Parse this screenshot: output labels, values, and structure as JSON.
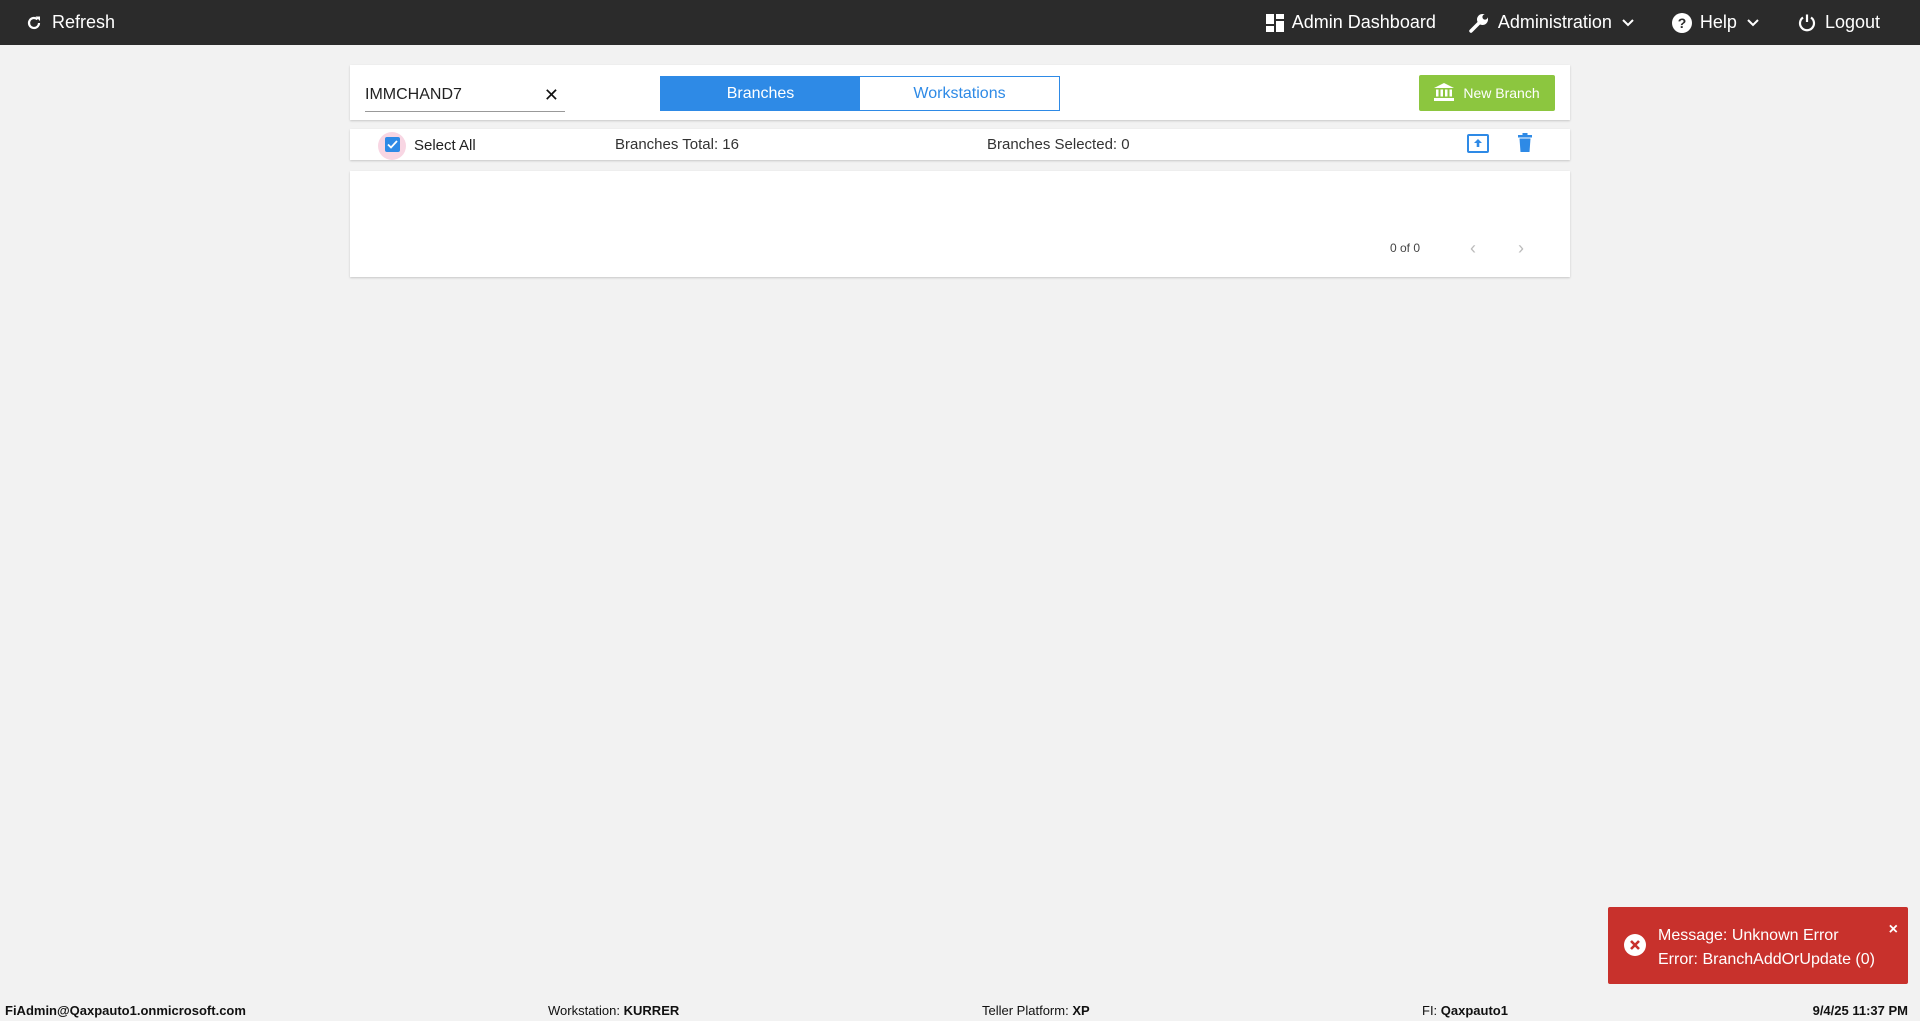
{
  "topbar": {
    "refresh_label": "Refresh",
    "admin_dashboard_label": "Admin Dashboard",
    "administration_label": "Administration",
    "help_label": "Help",
    "logout_label": "Logout"
  },
  "search": {
    "value": "IMMCHAND7",
    "clear_glyph": "✕"
  },
  "tabs": [
    {
      "label": "Branches",
      "active": true
    },
    {
      "label": "Workstations",
      "active": false
    }
  ],
  "new_branch_label": "New Branch",
  "select_bar": {
    "select_all_label": "Select All",
    "select_all_checked": true,
    "total_text": "Branches Total: 16",
    "selected_text": "Branches Selected: 0"
  },
  "pager": {
    "count_text": "0 of 0",
    "prev_glyph": "‹",
    "next_glyph": "›"
  },
  "toast": {
    "line1": "Message: Unknown Error",
    "line2": "Error: BranchAddOrUpdate (0)",
    "close_glyph": "×"
  },
  "statusbar": {
    "user": "FiAdmin@Qaxpauto1.onmicrosoft.com",
    "workstation_label": "Workstation:",
    "workstation_value": "KURRER",
    "platform_label": "Teller Platform:",
    "platform_value": "XP",
    "fi_label": "FI:",
    "fi_value": "Qaxpauto1",
    "datetime": "9/4/25 11:37 PM"
  },
  "colors": {
    "topbar": "#2b2b2b",
    "accent": "#2e8ae6",
    "new_branch": "#8cc63f",
    "toast": "#c8312c"
  },
  "icons": [
    "refresh-icon",
    "dashboard-icon",
    "wrench-icon",
    "help-icon",
    "power-icon",
    "bank-icon",
    "upload-icon",
    "trash-icon",
    "error-icon"
  ]
}
